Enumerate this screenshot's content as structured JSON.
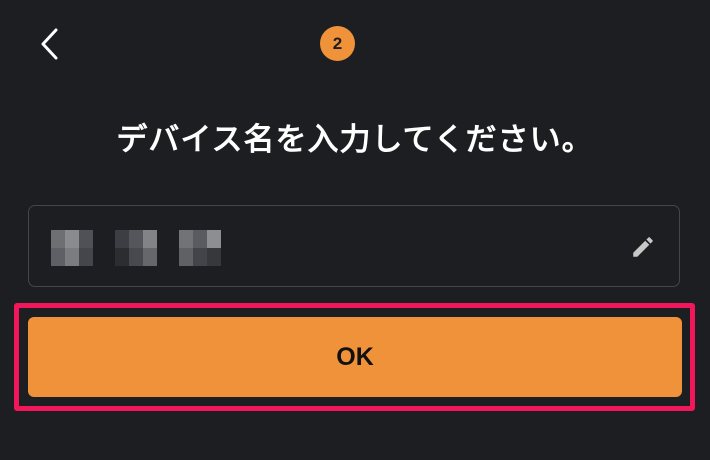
{
  "header": {
    "back_icon": "chevron-left-icon",
    "step_number": "2"
  },
  "main": {
    "title": "デバイス名を入力してください。",
    "device_name_field": {
      "value_masked": true,
      "edit_icon": "pencil-icon"
    },
    "ok_label": "OK"
  },
  "colors": {
    "background": "#1d1e21",
    "accent": "#f0923a",
    "highlight": "#f2165a",
    "field_border": "#44464b",
    "icon": "#c8c8c8"
  }
}
